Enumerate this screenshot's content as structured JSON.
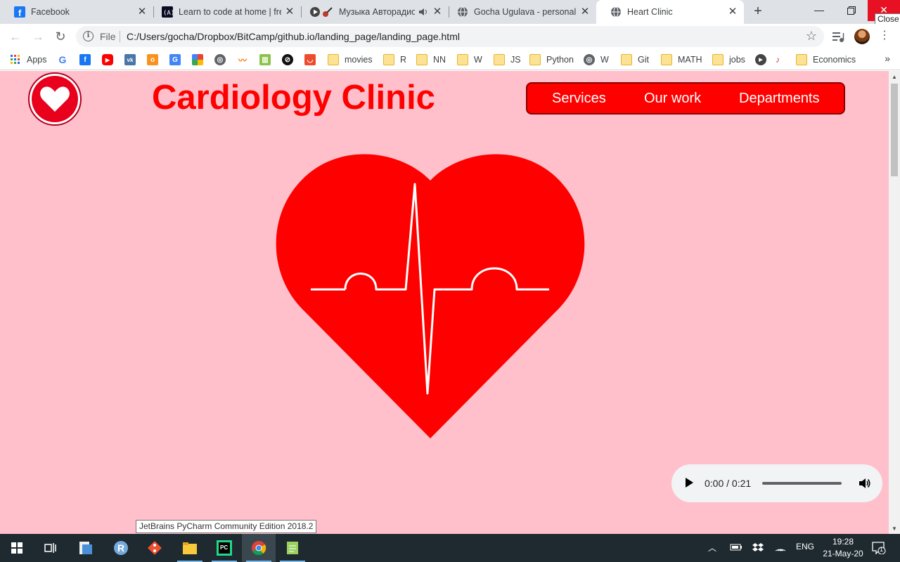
{
  "browser": {
    "tabs": [
      {
        "title": "Facebook",
        "icon": "facebook-icon"
      },
      {
        "title": "Learn to code at home | free",
        "icon": "freecodecamp-icon"
      },
      {
        "title": "Музыка Авторадио",
        "icon": "guitar-icon",
        "audio": true
      },
      {
        "title": "Gocha Ugulava - personal p",
        "icon": "globe-icon"
      },
      {
        "title": "Heart Clinic",
        "icon": "globe-icon",
        "active": true
      }
    ],
    "new_tab_label": "+",
    "close_tooltip": "Close",
    "address": {
      "scheme": "File",
      "url": "C:/Users/gocha/Dropbox/BitCamp/github.io/landing_page/landing_page.html"
    },
    "bookmarks": [
      {
        "label": "Apps",
        "icon": "apps-grid-icon"
      },
      {
        "label": "",
        "icon": "google-icon"
      },
      {
        "label": "",
        "icon": "facebook-icon"
      },
      {
        "label": "",
        "icon": "youtube-icon"
      },
      {
        "label": "",
        "icon": "vk-icon"
      },
      {
        "label": "",
        "icon": "odnoklassniki-icon"
      },
      {
        "label": "",
        "icon": "google-translate-icon"
      },
      {
        "label": "",
        "icon": "pinwheel-icon"
      },
      {
        "label": "",
        "icon": "globe-icon"
      },
      {
        "label": "",
        "icon": "orange-chart-icon"
      },
      {
        "label": "",
        "icon": "green-chart-icon"
      },
      {
        "label": "",
        "icon": "circle-slash-icon"
      },
      {
        "label": "",
        "icon": "shopping-bag-icon"
      },
      {
        "label": "movies",
        "icon": "folder-icon"
      },
      {
        "label": "R",
        "icon": "folder-icon"
      },
      {
        "label": "NN",
        "icon": "folder-icon"
      },
      {
        "label": "W",
        "icon": "folder-icon"
      },
      {
        "label": "JS",
        "icon": "folder-icon"
      },
      {
        "label": "Python",
        "icon": "folder-icon"
      },
      {
        "label": "W",
        "icon": "globe-icon"
      },
      {
        "label": "Git",
        "icon": "folder-icon"
      },
      {
        "label": "MATH",
        "icon": "folder-icon"
      },
      {
        "label": "jobs",
        "icon": "folder-icon"
      },
      {
        "label": "",
        "icon": "play-circle-icon"
      },
      {
        "label": "",
        "icon": "guitar-icon"
      },
      {
        "label": "Economics",
        "icon": "folder-icon"
      }
    ],
    "bookmarks_overflow": "»"
  },
  "page": {
    "title": "Cardiology Clinic",
    "nav": [
      "Services",
      "Our work",
      "Departments"
    ],
    "audio": {
      "time": "0:00 / 0:21"
    },
    "colors": {
      "background": "#ffc0cb",
      "accent": "#ff0000"
    }
  },
  "pycharm_tooltip": "JetBrains PyCharm Community Edition 2018.2",
  "taskbar": {
    "apps": [
      "start-icon",
      "task-view-icon",
      "files-icon",
      "r-icon",
      "git-icon",
      "file-explorer-icon",
      "pycharm-icon",
      "chrome-icon",
      "notepad-icon"
    ],
    "language": "ENG",
    "time": "19:28",
    "date": "21-May-20",
    "notifications": "1"
  }
}
